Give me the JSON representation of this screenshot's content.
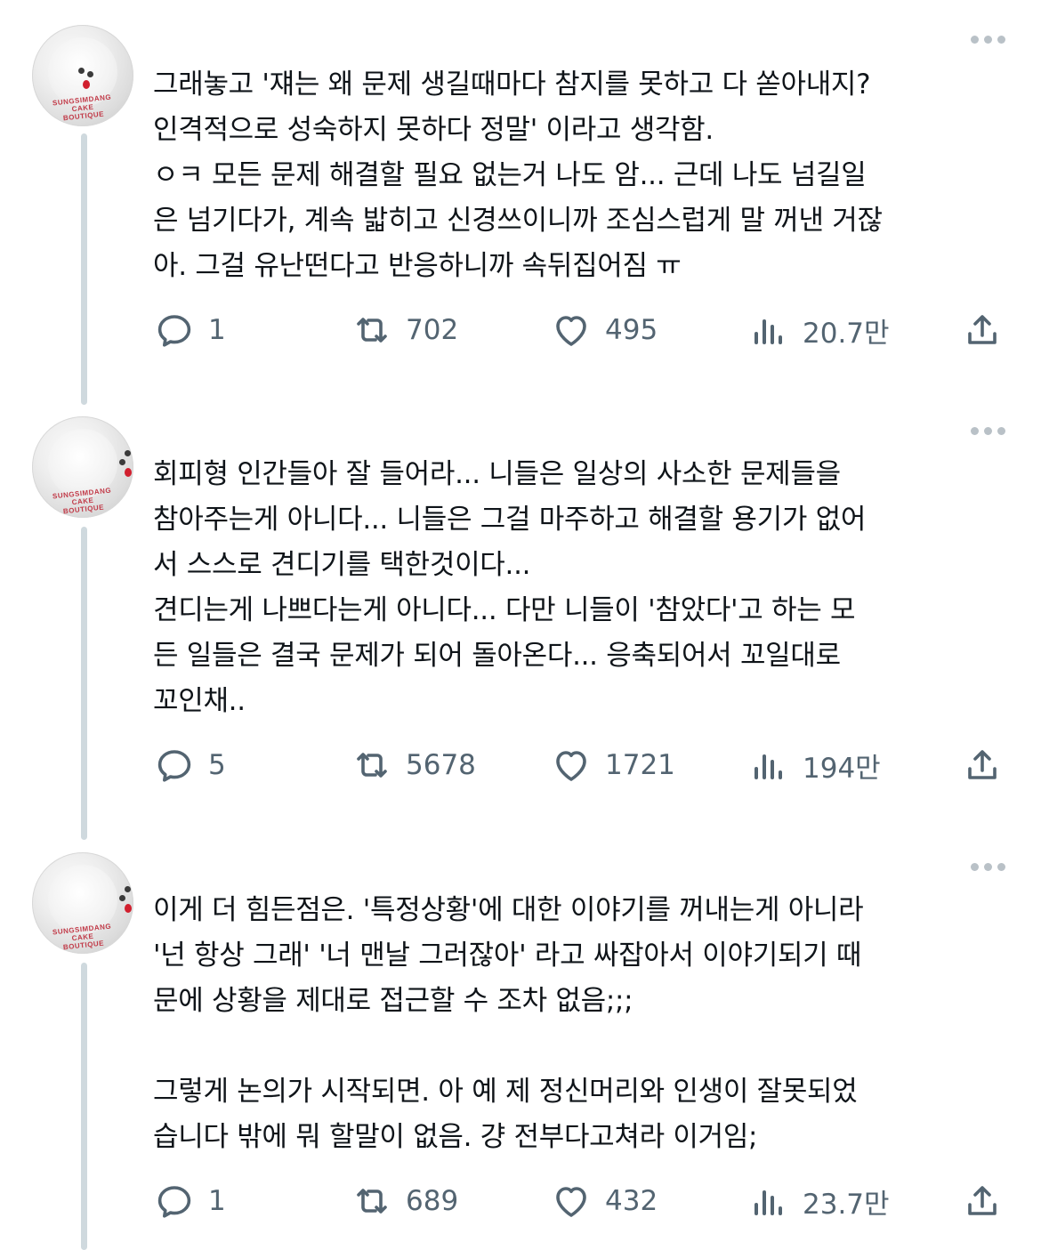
{
  "tweets": [
    {
      "avatar_label": "SUNGSIMDANG CAKE BOUTIQUE",
      "text": "그래놓고 '쟤는 왜 문제 생길때마다 참지를 못하고 다 쏟아내지?\n인격적으로 성숙하지 못하다 정말' 이라고 생각함.\nㅇㅋ 모든 문제 해결할 필요 없는거 나도 암... 근데 나도 넘길일\n은 넘기다가, 계속 밟히고 신경쓰이니까 조심스럽게 말 꺼낸 거잖\n아. 그걸 유난떤다고 반응하니까 속뒤집어짐 ㅠ",
      "replies": "1",
      "retweets": "702",
      "likes": "495",
      "views": "20.7만"
    },
    {
      "avatar_label": "SUNGSIMDANG CAKE BOUTIQUE",
      "text": "회피형 인간들아 잘 들어라... 니들은 일상의 사소한 문제들을\n참아주는게 아니다... 니들은 그걸 마주하고 해결할 용기가 없어\n서 스스로 견디기를 택한것이다...\n견디는게 나쁘다는게 아니다... 다만 니들이 '참았다'고 하는 모\n든 일들은 결국 문제가 되어 돌아온다... 응축되어서 꼬일대로\n꼬인채..",
      "replies": "5",
      "retweets": "5678",
      "likes": "1721",
      "views": "194만"
    },
    {
      "avatar_label": "SUNGSIMDANG CAKE BOUTIQUE",
      "text": "이게 더 힘든점은. '특정상황'에 대한 이야기를 꺼내는게 아니라\n'넌 항상 그래' '너 맨날 그러잖아' 라고 싸잡아서 이야기되기 때\n문에 상황을 제대로 접근할 수 조차 없음;;;\n\n그렇게 논의가 시작되면. 아 예 제 정신머리와 인생이 잘못되었\n습니다 밖에 뭐 할말이 없음. 걍 전부다고쳐라 이거임;",
      "replies": "1",
      "retweets": "689",
      "likes": "432",
      "views": "23.7만"
    }
  ],
  "icons": {
    "reply": "reply-icon",
    "retweet": "retweet-icon",
    "like": "heart-icon",
    "views": "views-icon",
    "share": "share-icon",
    "more": "more-icon"
  },
  "colors": {
    "text": "#0f1419",
    "secondary": "#536471",
    "thread_line": "#cfd9de"
  }
}
